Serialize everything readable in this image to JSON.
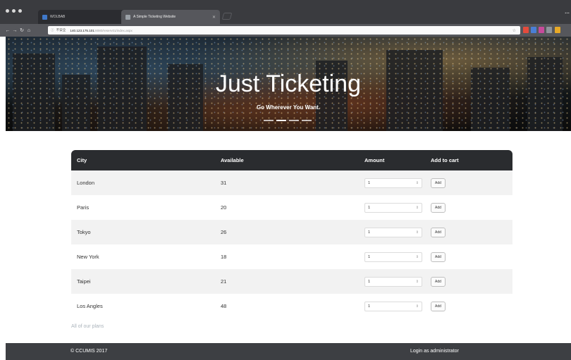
{
  "browser": {
    "tabs": [
      {
        "title": "WOLBAB",
        "favicon_color": "#3f78c9"
      },
      {
        "title": "A Simple Ticketing Website",
        "favicon_color": "#9aa0a6"
      }
    ],
    "address": {
      "scheme": "不安全",
      "host": "140.123.175.101",
      "path": ":8080/reserv01/index.aspx"
    },
    "top_right": "…",
    "colors": {
      "chrome_dark": "#3a3b3f",
      "chrome_mid": "#56575c"
    }
  },
  "hero": {
    "title": "Just Ticketing",
    "subtitle": "Go Wherever You Want."
  },
  "table": {
    "headers": {
      "city": "City",
      "available": "Available",
      "amount": "Amount",
      "add": "Add to cart"
    },
    "rows": [
      {
        "city": "London",
        "available": "31",
        "amount": "1",
        "add": "Add"
      },
      {
        "city": "Paris",
        "available": "20",
        "amount": "1",
        "add": "Add"
      },
      {
        "city": "Tokyo",
        "available": "26",
        "amount": "1",
        "add": "Add"
      },
      {
        "city": "New York",
        "available": "18",
        "amount": "1",
        "add": "Add"
      },
      {
        "city": "Taipei",
        "available": "21",
        "amount": "1",
        "add": "Add"
      },
      {
        "city": "Los Angles",
        "available": "48",
        "amount": "1",
        "add": "Add"
      }
    ]
  },
  "all_plans": "All of our plans",
  "footer": {
    "copyright": "© CCUMIS 2017",
    "login": "Login as administrator"
  },
  "colors": {
    "header_bg": "#2a2c2f",
    "stripe": "#f2f2f2",
    "footer_bg": "#3d3f43",
    "link": "#aab3bb"
  }
}
